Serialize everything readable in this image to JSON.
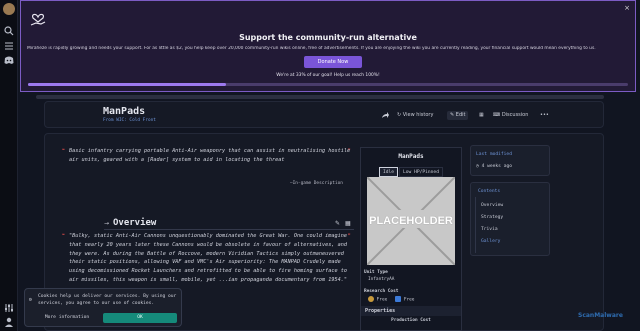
{
  "banner": {
    "heading": "Support the community-run alternative",
    "description": "Miraheze is rapidly growing and needs your support. For as little as $2, you help keep over 20,000 community-run wikis online, free of advertisements. If you are enjoying the wiki you are currently reading, your financial support would mean everything to us.",
    "donate_label": "Donate Now",
    "goal_text": "We're at 33% of our goal! Help us reach 100%!",
    "progress": 0.33,
    "close": "×",
    "accent": "#7c5cc4"
  },
  "page": {
    "title": "ManPads",
    "subtitle": "From WIC: Cold Front",
    "actions": {
      "history": "View history",
      "edit": "Edit",
      "discussion": "Discussion"
    }
  },
  "content": {
    "intro_quote": "Basic infantry carrying portable Anti-Air weaponry that can assist in neutralising hostile air units, geared with a [Radar] system to aid in locating the threat",
    "intro_caption": "—In-game Description",
    "overview_heading": "Overview",
    "overview_quote": "\"Bulky, static Anti-Air Cannons unquestionably dominated the Great War. One could imagine that nearly 20 years later these Cannons would be obsolete in favour of alternatives, and they were. As during the Battle of Roccove, modern Viridian Tactics simply outmaneuvered their static positions, allowing VAF and VMC's Air superiority: The MANPAD Crudely made using decomissioned Rocket Launchers and retrofitted to be able to fire homing surface to air missiles, this weapon is small, mobile, yet ...ian propaganda documentary from 1954.\""
  },
  "infobox": {
    "title": "ManPads",
    "tabs": [
      "Idle",
      "Low HP/Pinned"
    ],
    "image_label": "PLACEHOLDER",
    "unit_type_label": "Unit Type",
    "unit_type_value": "InfantryAA",
    "research_cost_label": "Research Cost",
    "costs": [
      {
        "value": "Free",
        "color": "#c89a3c"
      },
      {
        "value": "Free",
        "color": "#3c7ad8"
      }
    ],
    "properties_label": "Properties",
    "production_cost_label": "Production Cost"
  },
  "sidebar": {
    "last_modified_label": "Last modified",
    "last_modified_value": "4 weeks ago",
    "contents_label": "Contents",
    "toc": [
      {
        "label": "Overview",
        "link": false
      },
      {
        "label": "Strategy",
        "link": false
      },
      {
        "label": "Trivia",
        "link": false
      },
      {
        "label": "Gallery",
        "link": true
      }
    ]
  },
  "cookie": {
    "text": "Cookies help us deliver our services. By using our services, you agree to our use of cookies.",
    "more_label": "More information",
    "ok_label": "OK"
  },
  "watermark": "ScanMalware"
}
